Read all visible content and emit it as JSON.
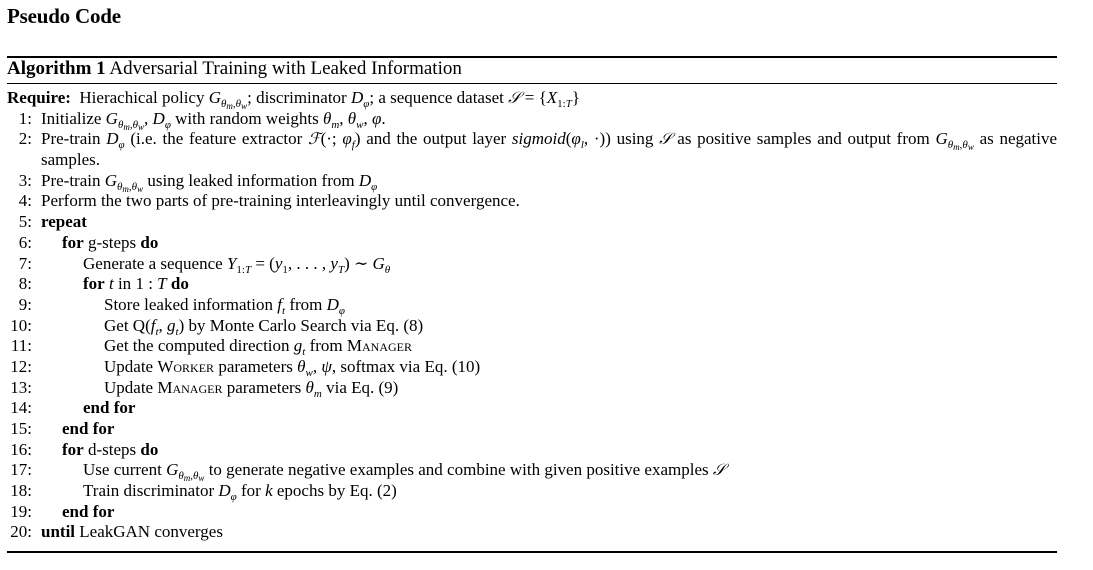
{
  "page": {
    "title": "Pseudo Code"
  },
  "algorithm": {
    "label": "Algorithm 1",
    "title": "Adversarial Training with Leaked Information",
    "require_keyword": "Require:",
    "kw": {
      "repeat": "repeat",
      "for": "for",
      "do": "do",
      "end_for": "end for",
      "until": "until",
      "in": "in"
    },
    "text": {
      "req_a": "Hierachical policy",
      "req_b": "; discriminator",
      "req_c": "; a sequence dataset",
      "l1_a": "Initialize",
      "l1_b": "with random weights",
      "l2_a": "Pre-train",
      "l2_b": "(i.e. the feature extractor",
      "l2_c": "and the output layer",
      "l2_d": "using",
      "l2_e": "as positive samples and output from",
      "l2_f": "as negative samples.",
      "l3_a": "Pre-train",
      "l3_b": "using leaked information from",
      "l4": "Perform the two parts of pre-training interleavingly until convergence.",
      "l6": "g-steps",
      "l7": "Generate a sequence",
      "l9_a": "Store leaked information",
      "l9_b": "from",
      "l10_a": "Get Q(",
      "l10_b": ") by Monte Carlo Search via Eq. (8)",
      "l11_a": "Get the computed direction",
      "l11_b": "from",
      "manager": "Manager",
      "worker": "Worker",
      "l12_a": "Update",
      "l12_b": "parameters",
      "l12_c": "softmax via Eq. (10)",
      "l13_a": "Update",
      "l13_b": "parameters",
      "l13_c": "via Eq. (9)",
      "l16": "d-steps",
      "l17_a": "Use current",
      "l17_b": "to generate negative examples and combine with given positive examples",
      "l18_a": "Train discriminator",
      "l18_b": "for",
      "l18_c": "epochs by Eq. (2)",
      "l20": "LeakGAN converges"
    },
    "line_numbers": [
      "1:",
      "2:",
      "3:",
      "4:",
      "5:",
      "6:",
      "7:",
      "8:",
      "9:",
      "10:",
      "11:",
      "12:",
      "13:",
      "14:",
      "15:",
      "16:",
      "17:",
      "18:",
      "19:",
      "20:"
    ]
  }
}
